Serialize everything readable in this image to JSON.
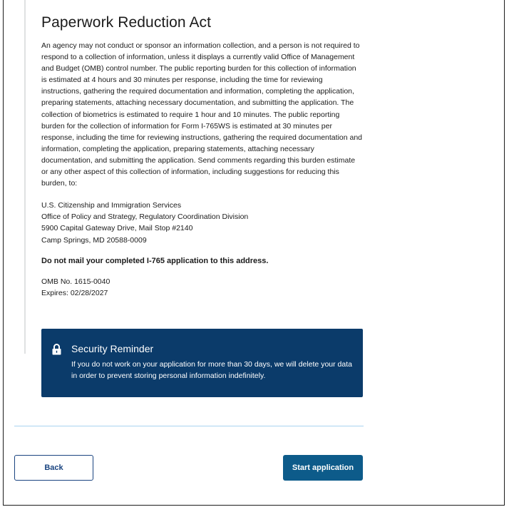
{
  "section": {
    "title": "Paperwork Reduction Act",
    "paragraph": "An agency may not conduct or sponsor an information collection, and a person is not required to respond to a collection of information, unless it displays a currently valid Office of Management and Budget (OMB) control number. The public reporting burden for this collection of information is estimated at 4 hours and 30 minutes per response, including the time for reviewing instructions, gathering the required documentation and information, completing the application, preparing statements, attaching necessary documentation, and submitting the application. The collection of biometrics is estimated to require 1 hour and 10 minutes. The public reporting burden for the collection of information for Form I-765WS is estimated at 30 minutes per response, including the time for reviewing instructions, gathering the required documentation and information, completing the application, preparing statements, attaching necessary documentation, and submitting the application. Send comments regarding this burden estimate or any other aspect of this collection of information, including suggestions for reducing this burden, to:",
    "address": {
      "line1": "U.S. Citizenship and Immigration Services",
      "line2": "Office of Policy and Strategy, Regulatory Coordination Division",
      "line3": "5900 Capital Gateway Drive, Mail Stop #2140",
      "line4": "Camp Springs, MD 20588-0009"
    },
    "warning": "Do not mail your completed I-765 application to this address.",
    "omb_number": "OMB No. 1615-0040",
    "expires": "Expires: 02/28/2027"
  },
  "reminder": {
    "icon": "lock-icon",
    "title": "Security Reminder",
    "body": "If you do not work on your application for more than 30 days, we will delete your data in order to prevent storing personal information indefinitely.",
    "background": "#0b3b6a"
  },
  "actions": {
    "back_label": "Back",
    "start_label": "Start application",
    "primary_color": "#0d5b8a"
  }
}
